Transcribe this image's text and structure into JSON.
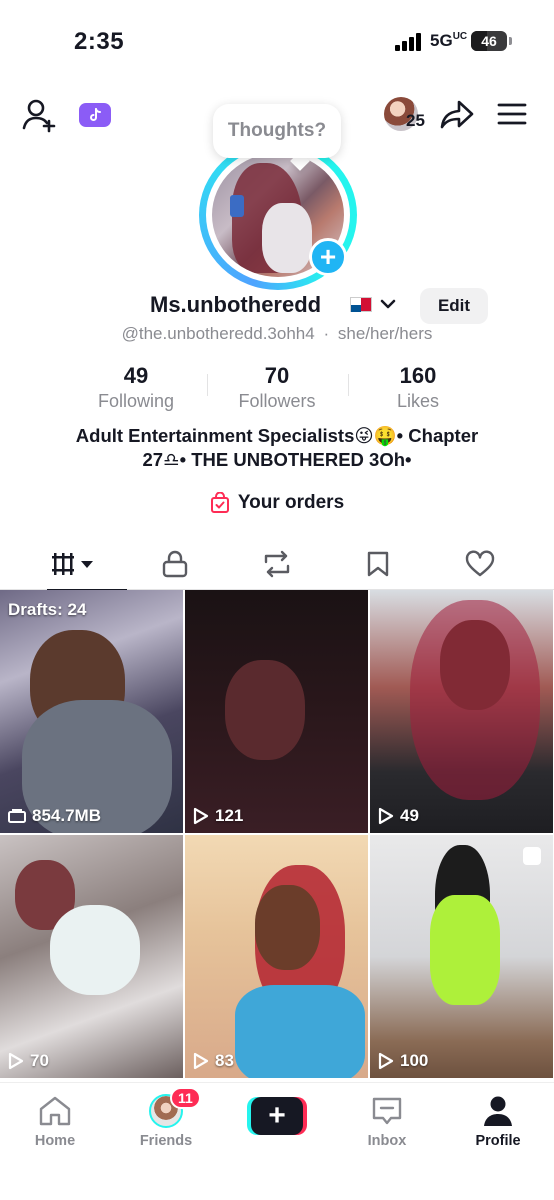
{
  "status_bar": {
    "time": "2:35",
    "network": "5G",
    "battery": "46"
  },
  "header": {
    "mini_avatar_count": "25"
  },
  "thoughts_bubble": "Thoughts?",
  "profile": {
    "display_name": "Ms.unbotheredd",
    "edit_label": "Edit",
    "handle": "@the.unbotheredd.3ohh4",
    "pronouns": "she/her/hers",
    "separator": "·"
  },
  "stats": [
    {
      "value": "49",
      "label": "Following"
    },
    {
      "value": "70",
      "label": "Followers"
    },
    {
      "value": "160",
      "label": "Likes"
    }
  ],
  "bio": {
    "line1": "Adult Entertainment Specialists😜🤑• Chapter",
    "line2": "27♎• THE UNBOTHERED 3Oh•"
  },
  "orders_label": "Your orders",
  "tabs": [
    {
      "icon": "videos-grid-icon",
      "active": true
    },
    {
      "icon": "lock-icon",
      "active": false
    },
    {
      "icon": "repost-icon",
      "active": false
    },
    {
      "icon": "bookmark-icon",
      "active": false
    },
    {
      "icon": "heart-icon",
      "active": false
    }
  ],
  "grid": {
    "drafts_label": "Drafts: 24",
    "items": [
      {
        "meta": "854.7MB",
        "meta_icon": "storage-icon"
      },
      {
        "meta": "121",
        "meta_icon": "play-icon"
      },
      {
        "meta": "49",
        "meta_icon": "play-icon"
      },
      {
        "meta": "70",
        "meta_icon": "play-icon"
      },
      {
        "meta": "83",
        "meta_icon": "play-icon"
      },
      {
        "meta": "100",
        "meta_icon": "play-icon"
      }
    ]
  },
  "bottom_nav": {
    "home": "Home",
    "friends": "Friends",
    "friends_badge": "11",
    "inbox": "Inbox",
    "profile": "Profile"
  },
  "colors": {
    "accent_red": "#fe2c55",
    "accent_cyan": "#25f4ee",
    "muted_text": "#8a8b91",
    "purple_badge": "#8b5cf6"
  }
}
